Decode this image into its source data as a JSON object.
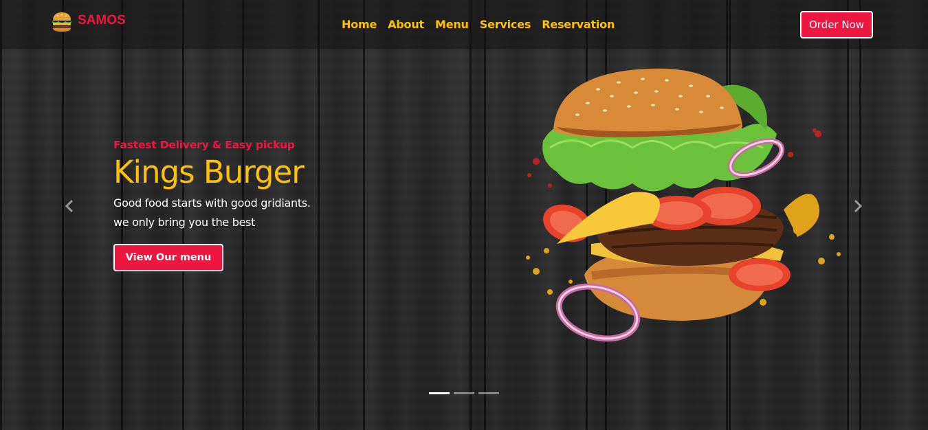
{
  "brand": {
    "name": "SAMOS",
    "icon": "burger-icon"
  },
  "nav": {
    "links": [
      {
        "label": "Home"
      },
      {
        "label": "About"
      },
      {
        "label": "Menu"
      },
      {
        "label": "Services"
      },
      {
        "label": "Reservation"
      }
    ],
    "order_label": "Order Now"
  },
  "hero": {
    "tagline": "Fastest Delivery & Easy pickup",
    "headline": "Kings Burger",
    "sub_line1": "Good food starts with good gridiants.",
    "sub_line2": "we only bring you the best",
    "cta_label": "View Our menu",
    "image": "burger-image"
  },
  "carousel": {
    "prev_icon": "chevron-left-icon",
    "next_icon": "chevron-right-icon",
    "slides": 3,
    "active_slide": 1
  },
  "colors": {
    "accent_red": "#ee1742",
    "accent_yellow": "#ffc107",
    "background": "#262626"
  }
}
